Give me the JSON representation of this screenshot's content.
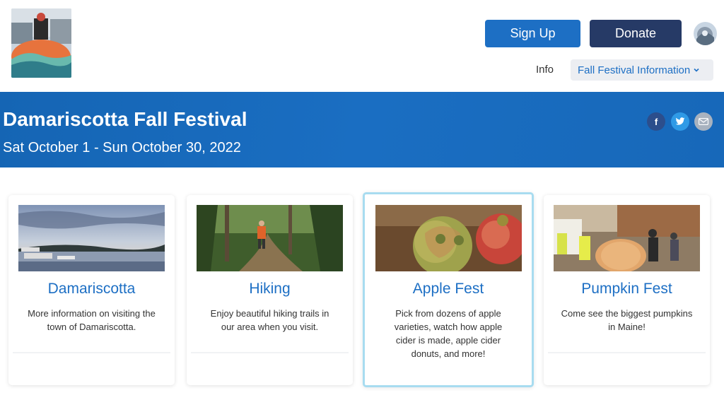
{
  "header": {
    "signup_label": "Sign Up",
    "donate_label": "Donate",
    "nav_info": "Info",
    "nav_dropdown": "Fall Festival Information"
  },
  "banner": {
    "title": "Damariscotta Fall Festival",
    "date": "Sat October 1 - Sun October 30, 2022",
    "share": {
      "facebook": "f",
      "twitter_icon": "twitter-bird-icon",
      "email_icon": "mail-icon"
    }
  },
  "colors": {
    "primary": "#1d6fc4",
    "donate": "#263a66",
    "banner": "#1a6ec2",
    "active_border": "#a8dcf0"
  },
  "cards": [
    {
      "title": "Damariscotta",
      "desc": "More information on visiting the town of Damariscotta."
    },
    {
      "title": "Hiking",
      "desc": "Enjoy beautiful hiking trails in our area when you visit."
    },
    {
      "title": "Apple Fest",
      "desc": "Pick from dozens of apple varieties, watch how apple cider is made, apple cider donuts, and more!"
    },
    {
      "title": "Pumpkin Fest",
      "desc": "Come see the biggest pumpkins in Maine!"
    }
  ]
}
